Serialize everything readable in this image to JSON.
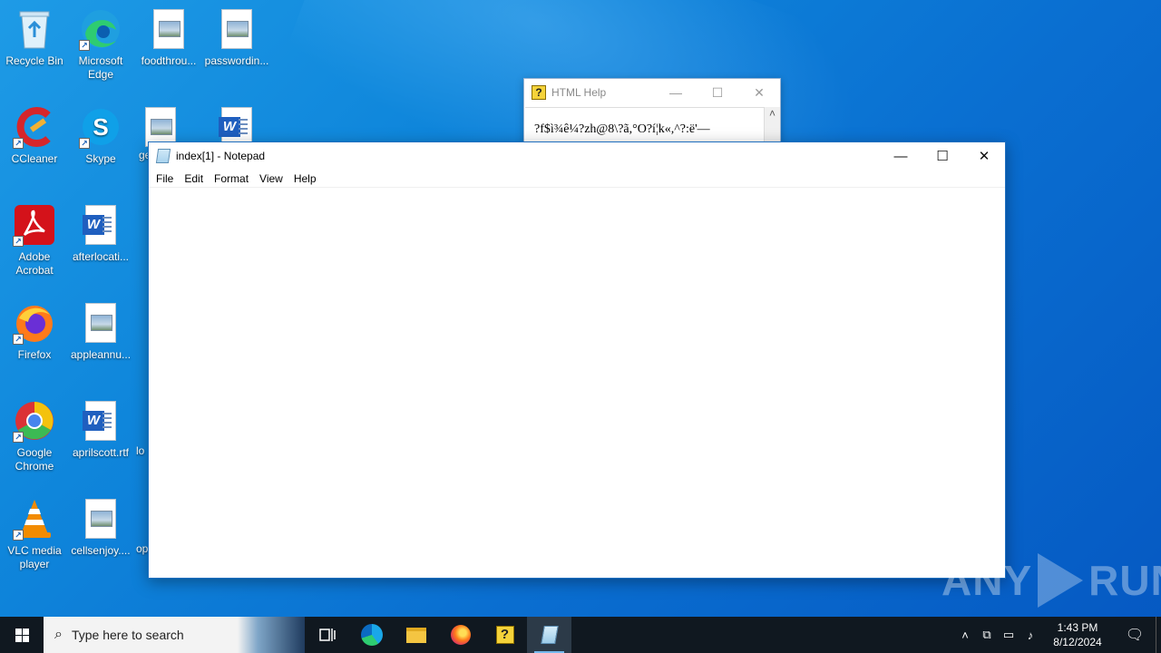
{
  "desktop": {
    "icons": [
      {
        "label": "Recycle Bin",
        "icon": "recycle-bin-icon"
      },
      {
        "label": "Microsoft Edge",
        "icon": "edge-icon"
      },
      {
        "label": "foodthrou...",
        "icon": "image-file-icon"
      },
      {
        "label": "passwordin...",
        "icon": "image-file-icon"
      },
      {
        "label": "CCleaner",
        "icon": "ccleaner-icon"
      },
      {
        "label": "Skype",
        "icon": "skype-icon"
      },
      {
        "label": "ge",
        "icon": "image-file-icon"
      },
      {
        "label": "",
        "icon": "word-file-icon"
      },
      {
        "label": "Adobe Acrobat",
        "icon": "acrobat-icon"
      },
      {
        "label": "afterlocati...",
        "icon": "word-file-icon"
      },
      {
        "label": "Firefox",
        "icon": "firefox-icon"
      },
      {
        "label": "appleannu...",
        "icon": "image-file-icon"
      },
      {
        "label": "Google Chrome",
        "icon": "chrome-icon"
      },
      {
        "label": "aprilscott.rtf",
        "icon": "word-file-icon"
      },
      {
        "label": "lo",
        "icon": "file-icon"
      },
      {
        "label": "VLC media player",
        "icon": "vlc-icon"
      },
      {
        "label": "cellsenjoy....",
        "icon": "image-file-icon"
      },
      {
        "label": "op",
        "icon": "file-icon"
      }
    ]
  },
  "help_window": {
    "title": "HTML Help",
    "content": "?f$ì¾ê¼?zh@8\\?ã,°O?í¦k«,^?:ë'—",
    "minimize": "—",
    "maximize": "☐",
    "close": "✕",
    "scroll_up": "˄"
  },
  "notepad": {
    "title": "index[1] - Notepad",
    "minimize": "—",
    "maximize": "☐",
    "close": "✕",
    "menu": [
      "File",
      "Edit",
      "Format",
      "View",
      "Help"
    ],
    "content": ""
  },
  "watermark": {
    "left": "ANY",
    "right": "RUN"
  },
  "taskbar": {
    "search_placeholder": "Type here to search",
    "time": "1:43 PM",
    "date": "8/12/2024",
    "tray_icons": [
      "chevron-up-icon",
      "network-device-icon",
      "network-icon",
      "volume-icon"
    ],
    "active_app": "notepad"
  }
}
